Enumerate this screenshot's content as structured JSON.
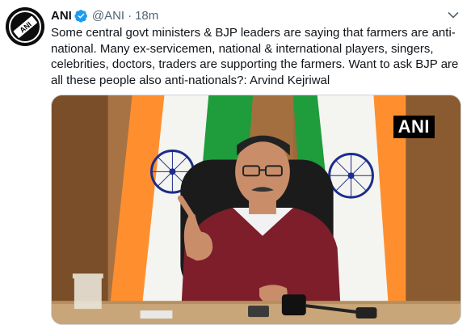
{
  "tweet": {
    "author_name": "ANI",
    "handle": "@ANI",
    "separator": "·",
    "time": "18m",
    "text": "Some central govt ministers & BJP leaders are saying that farmers are anti-national. Many ex-servicemen, national & international players, singers, celebrities, doctors, traders are supporting the farmers. Want to ask BJP are all these people also anti-nationals?: Arvind Kejriwal",
    "verified": true,
    "media": {
      "watermark": "ANI"
    },
    "avatar_text": "ANI"
  },
  "colors": {
    "verified_blue": "#1d9bf0",
    "secondary_text": "#536471",
    "primary_text": "#0f1419"
  },
  "icons": {
    "verified": "verified-badge-icon",
    "more": "chevron-down-icon"
  }
}
